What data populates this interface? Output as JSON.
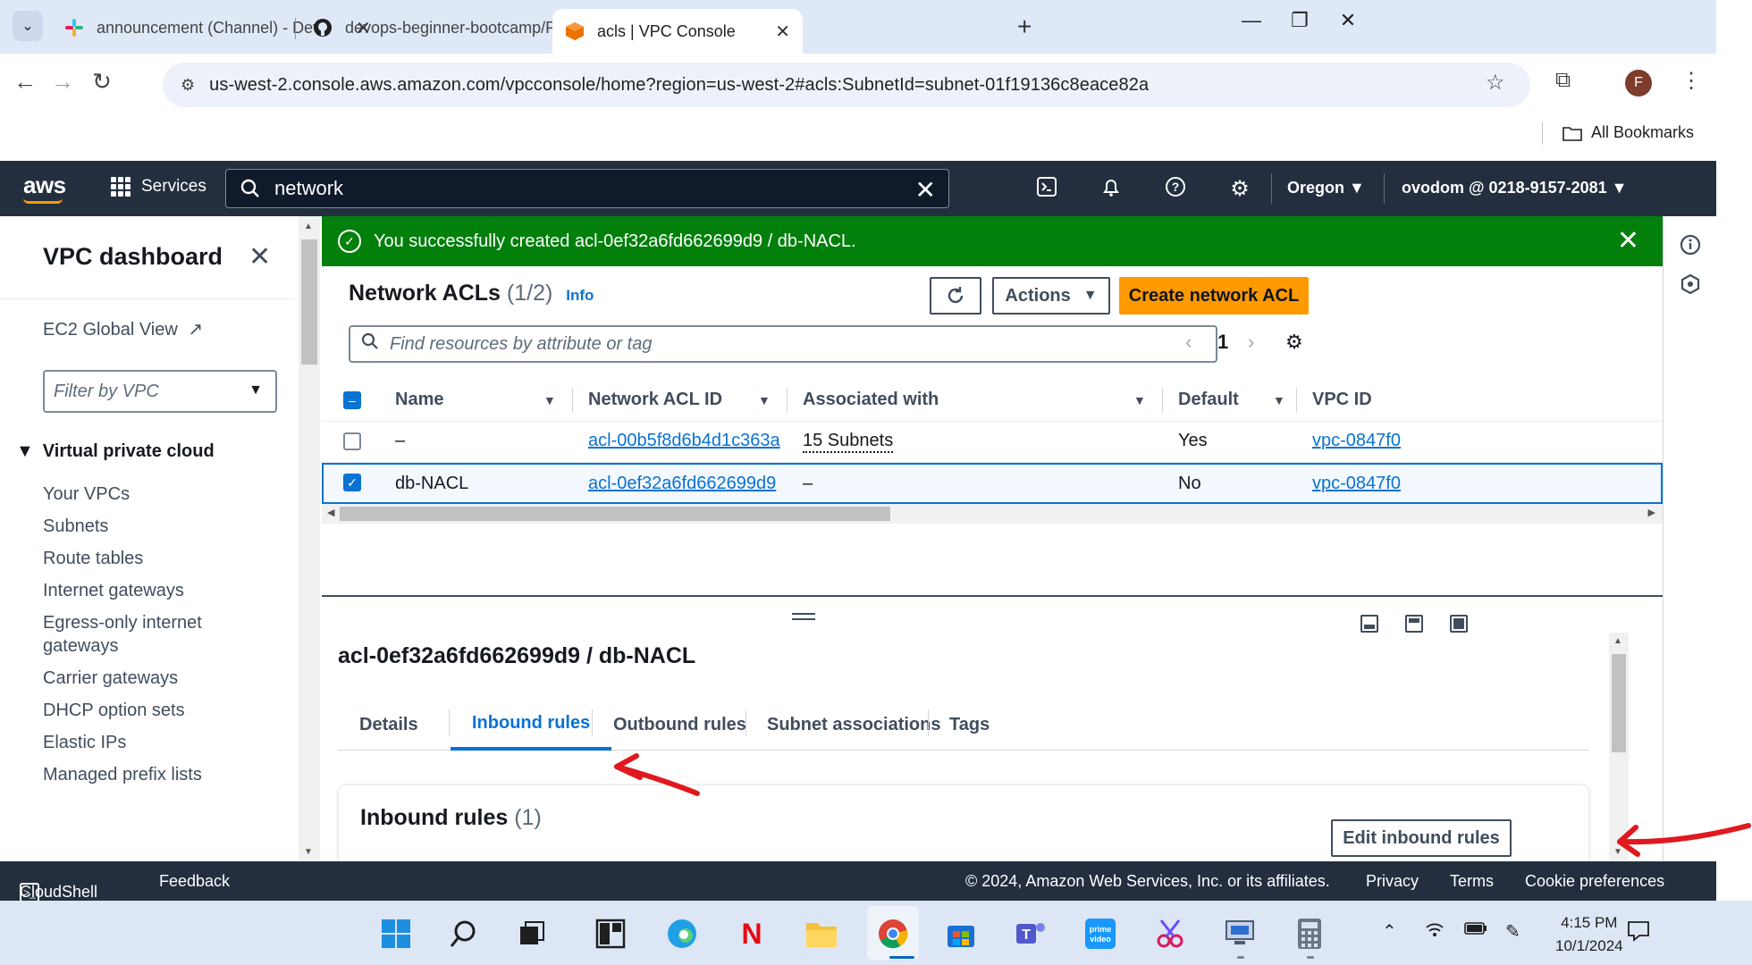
{
  "browser": {
    "tabs": [
      {
        "title": "announcement (Channel) - Dev",
        "icon": "slack-icon"
      },
      {
        "title": "devops-beginner-bootcamp/Pr",
        "icon": "github-icon"
      },
      {
        "title": "acls | VPC Console",
        "icon": "vpc-icon",
        "active": true
      }
    ],
    "url": "us-west-2.console.aws.amazon.com/vpcconsole/home?region=us-west-2#acls:SubnetId=subnet-01f19136c8eace82a",
    "avatar_initial": "F",
    "bookmarks_label": "All Bookmarks"
  },
  "aws_header": {
    "logo": "aws",
    "services_label": "Services",
    "search_value": "network",
    "region": "Oregon",
    "account": "ovodom @ 0218-9157-2081"
  },
  "sidebar": {
    "title": "VPC dashboard",
    "ec2_global_view": "EC2 Global View",
    "filter_placeholder": "Filter by VPC",
    "section": "Virtual private cloud",
    "items": [
      "Your VPCs",
      "Subnets",
      "Route tables",
      "Internet gateways",
      "Egress-only internet",
      "gateways",
      "Carrier gateways",
      "DHCP option sets",
      "Elastic IPs",
      "Managed prefix lists"
    ]
  },
  "flash": {
    "message": "You successfully created acl-0ef32a6fd662699d9 / db-NACL."
  },
  "acl_panel": {
    "title": "Network ACLs",
    "count": "(1/2)",
    "info": "Info",
    "actions_label": "Actions",
    "create_label": "Create network ACL",
    "search_placeholder": "Find resources by attribute or tag",
    "page": "1",
    "columns": [
      "Name",
      "Network ACL ID",
      "Associated with",
      "Default",
      "VPC ID"
    ],
    "rows": [
      {
        "name": "–",
        "acl_id": "acl-00b5f8d6b4d1c363a",
        "associated": "15 Subnets",
        "default": "Yes",
        "vpc": "vpc-0847f0",
        "selected": false
      },
      {
        "name": "db-NACL",
        "acl_id": "acl-0ef32a6fd662699d9",
        "associated": "–",
        "default": "No",
        "vpc": "vpc-0847f0",
        "selected": true
      }
    ]
  },
  "detail": {
    "title": "acl-0ef32a6fd662699d9 / db-NACL",
    "tabs": [
      "Details",
      "Inbound rules",
      "Outbound rules",
      "Subnet associations",
      "Tags"
    ],
    "active_tab": "Inbound rules",
    "rules_title": "Inbound rules",
    "rules_count": "(1)",
    "edit_label": "Edit inbound rules"
  },
  "footer": {
    "cloudshell": "CloudShell",
    "feedback": "Feedback",
    "copyright": "© 2024, Amazon Web Services, Inc. or its affiliates.",
    "privacy": "Privacy",
    "terms": "Terms",
    "cookies": "Cookie preferences"
  },
  "taskbar": {
    "time": "4:15 PM",
    "date": "10/1/2024"
  },
  "colors": {
    "aws_navy": "#232f3e",
    "aws_orange": "#ff9900",
    "success_green": "#037f0c",
    "link_blue": "#0972d3",
    "annotation_red": "#e0191f"
  }
}
